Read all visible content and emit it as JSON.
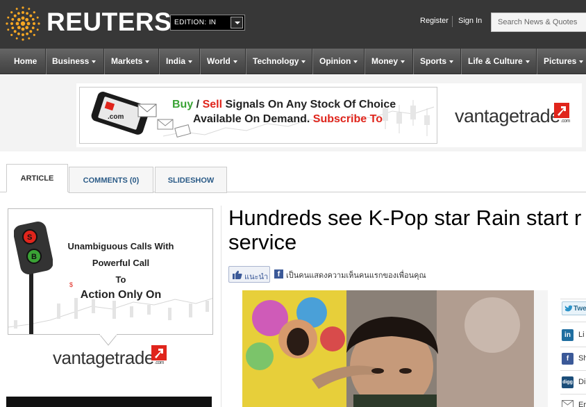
{
  "header": {
    "logo_text": "REUTERS",
    "edition_label": "EDITION:",
    "edition_value": "IN",
    "register_label": "Register",
    "signin_label": "Sign In",
    "search_placeholder": "Search News & Quotes"
  },
  "nav": {
    "items": [
      {
        "label": "Home",
        "dropdown": false
      },
      {
        "label": "Business",
        "dropdown": true
      },
      {
        "label": "Markets",
        "dropdown": true
      },
      {
        "label": "India",
        "dropdown": true
      },
      {
        "label": "World",
        "dropdown": true
      },
      {
        "label": "Technology",
        "dropdown": true
      },
      {
        "label": "Opinion",
        "dropdown": true
      },
      {
        "label": "Money",
        "dropdown": true
      },
      {
        "label": "Sports",
        "dropdown": true
      },
      {
        "label": "Life & Culture",
        "dropdown": true
      },
      {
        "label": "Pictures",
        "dropdown": true
      }
    ]
  },
  "top_ad": {
    "buy": "Buy",
    "slash": " / ",
    "sell": "Sell",
    "line1_rest": " Signals On Any Stock Of Choice",
    "line2_start": "Available On Demand. ",
    "subscribe": "Subscribe To",
    "phone_text": ".com",
    "brand": "vantagetrade",
    "brand_suffix": ".com"
  },
  "tabs": {
    "article": "ARTICLE",
    "comments": "COMMENTS (0)",
    "slideshow": "SLIDESHOW"
  },
  "side_ad": {
    "line1": "Unambiguous Calls With",
    "line2": "Powerful Call",
    "line3": "To",
    "line4": "Action Only On",
    "signal_s": "S",
    "signal_b": "B",
    "brand": "vantagetrade",
    "brand_suffix": ".com"
  },
  "article": {
    "headline_line1": "Hundreds see K-Pop star Rain start r",
    "headline_line2": "service",
    "like_label": "แนะนำ",
    "fb_social_text": "เป็นคนแสดงความเห็นคนแรกของเพื่อนคุณ"
  },
  "share": {
    "tweet": "Twe",
    "linkedin_icon": "in",
    "linkedin_label": "Li",
    "facebook_icon": "f",
    "facebook_label": "Sh",
    "digg_icon": "digg",
    "digg_label": "Di",
    "email_label": "Er"
  },
  "colors": {
    "header_bg": "#373737",
    "logo_orange": "#f5a623",
    "ad_green": "#3aa335",
    "ad_red": "#e0251c",
    "link_blue": "#2b5b87",
    "facebook_blue": "#3b5998"
  }
}
